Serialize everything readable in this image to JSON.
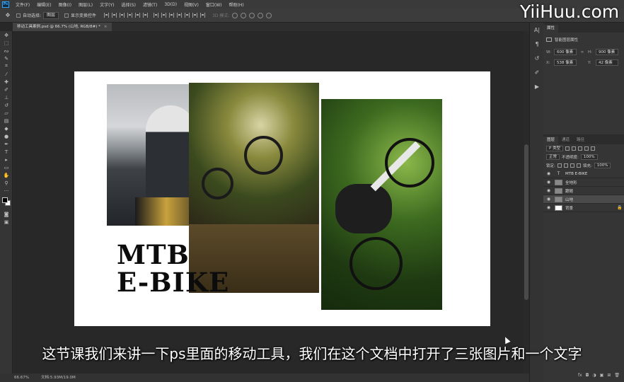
{
  "app": {
    "logo": "Ps"
  },
  "menu": [
    "文件(F)",
    "编辑(E)",
    "图像(I)",
    "图层(L)",
    "文字(Y)",
    "选择(S)",
    "滤镜(T)",
    "3D(D)",
    "视图(V)",
    "窗口(W)",
    "帮助(H)"
  ],
  "options": {
    "auto_select_label": "自动选择:",
    "auto_select_value": "图层",
    "show_transform_label": "显示变换控件",
    "mode3d_label": "3D 模式:"
  },
  "document": {
    "tab_title": "移动工具案例.psd @ 66.7% (山地, RGB/8#) *",
    "close": "×",
    "canvas_text": "MTB\nE-BIKE"
  },
  "status": {
    "zoom": "66.67%",
    "doc_info": "文档:5.93M/19.0M"
  },
  "properties": {
    "tab": "属性",
    "subtitle": "智能图层属性",
    "w_label": "W:",
    "w_value": "600 像素",
    "h_label": "H:",
    "h_value": "900 像素",
    "x_label": "X:",
    "x_value": "538 像素",
    "y_label": "Y:",
    "y_value": "42 像素",
    "link": "∞"
  },
  "layers_panel": {
    "tabs": [
      "图层",
      "通道",
      "路径"
    ],
    "kind_filter": "P 类型",
    "blend_mode": "正常",
    "opacity_label": "不透明度:",
    "opacity_value": "100%",
    "lock_label": "锁定:",
    "fill_label": "填充:",
    "fill_value": "100%",
    "layers": [
      {
        "name": "MTB E-BIKE",
        "type": "text",
        "visible": true,
        "selected": false
      },
      {
        "name": "全地形",
        "type": "image",
        "visible": true,
        "selected": false
      },
      {
        "name": "跟随",
        "type": "image",
        "visible": true,
        "selected": false
      },
      {
        "name": "山地",
        "type": "image",
        "visible": true,
        "selected": true
      },
      {
        "name": "背景",
        "type": "background",
        "visible": true,
        "selected": false,
        "locked": true
      }
    ],
    "footer_icons": [
      "fx",
      "◘",
      "◑",
      "▣",
      "⊞",
      "🗑"
    ]
  },
  "subtitle": "这节课我们来讲一下ps里面的移动工具，我们在这个文档中打开了三张图片和一个文字",
  "watermark": "YiiHuu.com"
}
